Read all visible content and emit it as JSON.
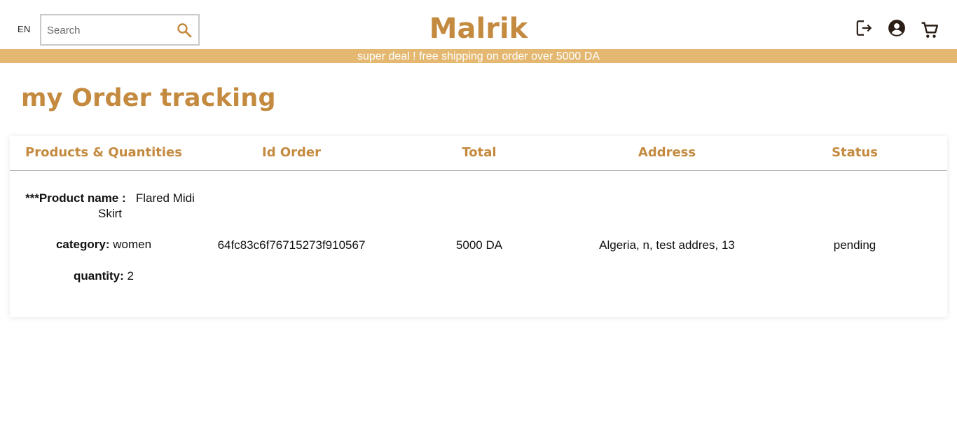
{
  "header": {
    "lang": "EN",
    "search_placeholder": "Search",
    "brand": "Malrik",
    "icons": [
      "logout-icon",
      "account-icon",
      "cart-icon"
    ]
  },
  "banner": {
    "text": "super deal ! free shipping on order over 5000 DA"
  },
  "page": {
    "title": "my Order tracking"
  },
  "table": {
    "columns": [
      "Products & Quantities",
      "Id Order",
      "Total",
      "Address",
      "Status"
    ],
    "rows": [
      {
        "product_label": "***Product name :",
        "product_name": "Flared Midi Skirt",
        "category_label": "category:",
        "category": "women",
        "quantity_label": "quantity:",
        "quantity": "2",
        "id_order": "64fc83c6f76715273f910567",
        "total": "5000 DA",
        "address": "Algeria, n, test addres, 13",
        "status": "pending"
      }
    ]
  },
  "colors": {
    "accent": "#c48a3f",
    "banner": "#e4b870",
    "icon": "#2b1e16"
  }
}
